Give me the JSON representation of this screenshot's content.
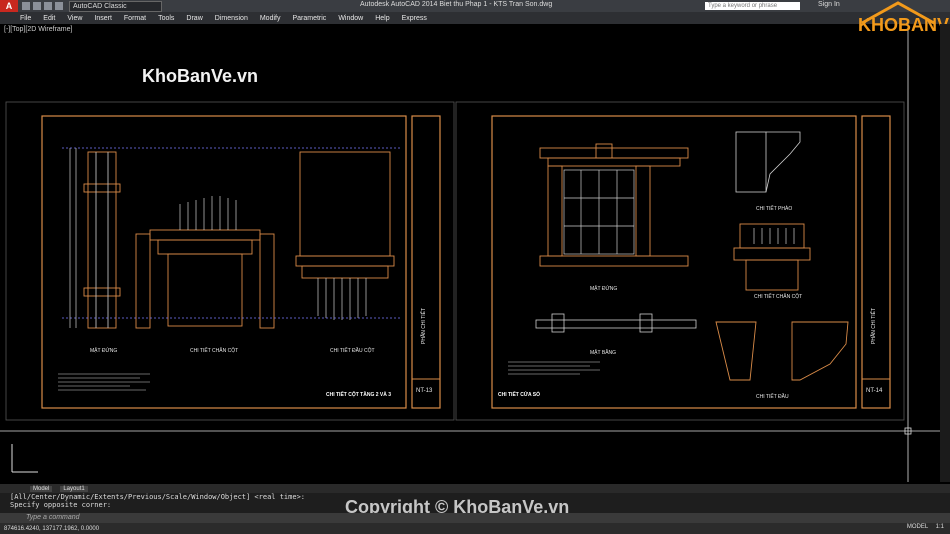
{
  "titlebar": {
    "workspace": "AutoCAD Classic",
    "window_title": "Autodesk AutoCAD 2014  Biet thu Phap 1 - KTS Tran Son.dwg",
    "search_placeholder": "Type a keyword or phrase",
    "signin": "Sign In"
  },
  "menu": [
    "File",
    "Edit",
    "View",
    "Insert",
    "Format",
    "Tools",
    "Draw",
    "Dimension",
    "Modify",
    "Parametric",
    "Window",
    "Help",
    "Express"
  ],
  "viewport": {
    "label": "[-][Top][2D Wireframe]",
    "watermark": "KhoBanVe.vn",
    "logo": "KHOBANVE"
  },
  "sheet1": {
    "labels": [
      "MẶT ĐỨNG",
      "CHI TIẾT CHÂN CỘT",
      "CHI TIẾT ĐẦU CỘT",
      "CHI TIẾT CỘT TẦNG 2 VÀ 3"
    ],
    "side": "PHẦN CHI TIẾT",
    "number": "NT-13"
  },
  "sheet2": {
    "labels": [
      "MẶT ĐỨNG",
      "MẶT BẰNG",
      "CHI TIẾT CỬA SỔ",
      "CHI TIẾT PHÀO",
      "CHI TIẾT CHÂN CỘT",
      "CHI TIẾT ĐẦU"
    ],
    "side": "PHẦN CHI TIẾT",
    "number": "NT-14"
  },
  "tabs": [
    "Model",
    "Layout1"
  ],
  "command": {
    "line1": "[All/Center/Dynamic/Extents/Previous/Scale/Window/Object] <real time>:",
    "line2": "Specify opposite corner:",
    "placeholder": "Type a command"
  },
  "copyright": "Copyright © KhoBanVe.vn",
  "status": {
    "coords": "874616.4240, 137177.1962, 0.0000",
    "model": "MODEL",
    "scale": "1:1"
  },
  "colors": {
    "frame": "#d98b48",
    "line": "#cfcfcf",
    "accent": "#f29a1b"
  }
}
